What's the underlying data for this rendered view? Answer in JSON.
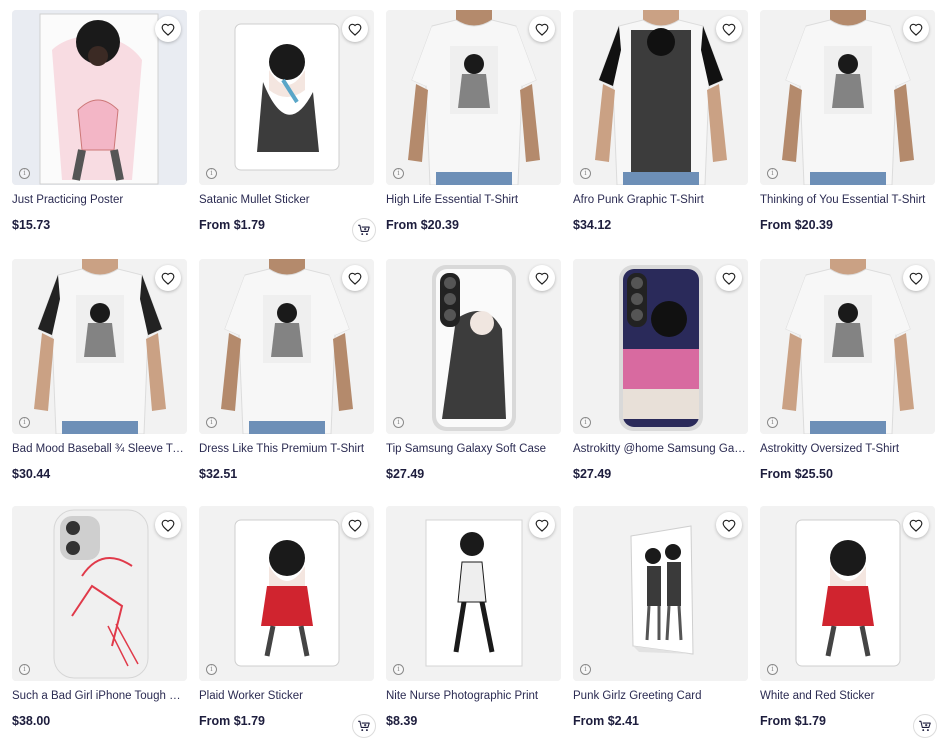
{
  "products": [
    {
      "title": "Just Practicing Poster",
      "price": "$15.73",
      "kind": "poster",
      "show_cart": false
    },
    {
      "title": "Satanic Mullet Sticker",
      "price": "From $1.79",
      "kind": "sticker",
      "show_cart": true
    },
    {
      "title": "High Life Essential T-Shirt",
      "price": "From $20.39",
      "kind": "tshirt",
      "show_cart": false
    },
    {
      "title": "Afro Punk Graphic T-Shirt",
      "price": "$34.12",
      "kind": "graphic-tee",
      "show_cart": false
    },
    {
      "title": "Thinking of You Essential T-Shirt",
      "price": "From $20.39",
      "kind": "tshirt",
      "show_cart": false
    },
    {
      "title": "Bad Mood Baseball ¾ Sleeve T-Shirt",
      "display_title": "Bad Mood Baseball ¾ Sleeve T-S...",
      "price": "$30.44",
      "kind": "baseball-tee",
      "show_cart": false
    },
    {
      "title": "Dress Like This Premium T-Shirt",
      "price": "$32.51",
      "kind": "tshirt",
      "show_cart": false
    },
    {
      "title": "Tip Samsung Galaxy Soft Case",
      "price": "$27.49",
      "kind": "phone-case",
      "show_cart": false
    },
    {
      "title": "Astrokitty @home Samsung Galaxy Soft Case",
      "display_title": "Astrokitty @home Samsung Gala...",
      "price": "$27.49",
      "kind": "phone-case-color",
      "show_cart": false
    },
    {
      "title": "Astrokitty Oversized T-Shirt",
      "price": "From $25.50",
      "kind": "tshirt",
      "show_cart": false
    },
    {
      "title": "Such a Bad Girl iPhone Tough Case",
      "price": "$38.00",
      "kind": "iphone-case",
      "show_cart": false
    },
    {
      "title": "Plaid Worker Sticker",
      "price": "From $1.79",
      "kind": "sticker",
      "show_cart": true
    },
    {
      "title": "Nite Nurse Photographic Print",
      "price": "$8.39",
      "kind": "print",
      "show_cart": false
    },
    {
      "title": "Punk Girlz Greeting Card",
      "price": "From $2.41",
      "kind": "card",
      "show_cart": false
    },
    {
      "title": "White and Red Sticker",
      "price": "From $1.79",
      "kind": "sticker",
      "show_cart": true
    }
  ],
  "icons": {
    "favorite": "heart-outline-icon",
    "info": "info-icon",
    "cart": "add-to-cart-icon"
  },
  "colors": {
    "text": "#2b2b52",
    "price": "#1d1d3d",
    "tile_bg": "#f2f2f2"
  }
}
